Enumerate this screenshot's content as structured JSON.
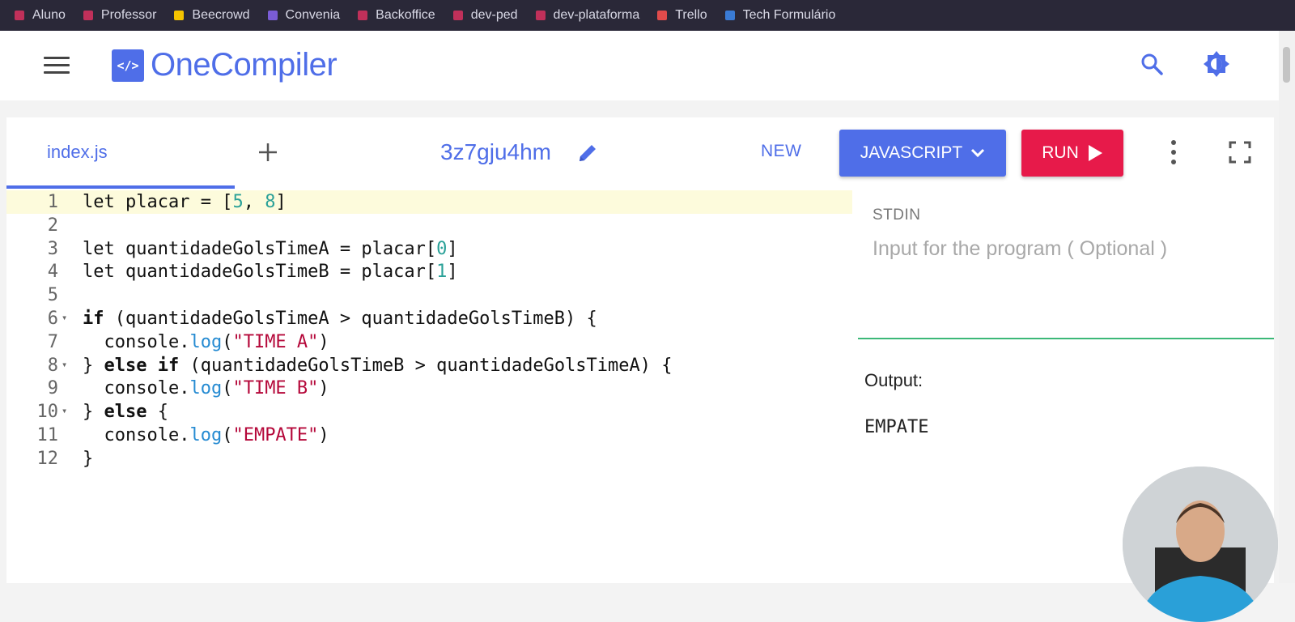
{
  "bookmarks": [
    {
      "label": "Aluno",
      "color": "#c0305a"
    },
    {
      "label": "Professor",
      "color": "#c0305a"
    },
    {
      "label": "Beecrowd",
      "color": "#f5c400"
    },
    {
      "label": "Convenia",
      "color": "#7a5cd6"
    },
    {
      "label": "Backoffice",
      "color": "#c0305a"
    },
    {
      "label": "dev-ped",
      "color": "#c0305a"
    },
    {
      "label": "dev-plataforma",
      "color": "#c0305a"
    },
    {
      "label": "Trello",
      "color": "#e04b4b"
    },
    {
      "label": "Tech Formulário",
      "color": "#3a7bd5"
    }
  ],
  "header": {
    "logo_mark": "</>",
    "logo_text": "OneCompiler"
  },
  "toolbar": {
    "file_tab": "index.js",
    "code_name": "3z7gju4hm",
    "new_label": "NEW",
    "language_label": "JAVASCRIPT",
    "run_label": "RUN"
  },
  "editor": {
    "lines": [
      "let placar = [5, 8]",
      "",
      "let quantidadeGolsTimeA = placar[0]",
      "let quantidadeGolsTimeB = placar[1]",
      "",
      "if (quantidadeGolsTimeA > quantidadeGolsTimeB) {",
      "  console.log(\"TIME A\")",
      "} else if (quantidadeGolsTimeB > quantidadeGolsTimeA) {",
      "  console.log(\"TIME B\")",
      "} else {",
      "  console.log(\"EMPATE\")",
      "}"
    ],
    "active_line": 1,
    "fold_lines": [
      6,
      8,
      10
    ]
  },
  "stdin": {
    "label": "STDIN",
    "placeholder": "Input for the program ( Optional )"
  },
  "output": {
    "label": "Output:",
    "text": "EMPATE"
  },
  "colors": {
    "accent": "#4f6ee8",
    "run": "#e71a4a",
    "divider": "#3cb878"
  }
}
